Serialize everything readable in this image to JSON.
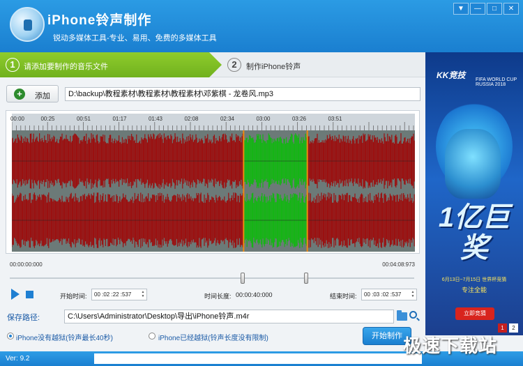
{
  "header": {
    "title": "iPhone铃声制作",
    "subtitle": "锐动多媒体工具-专业、易用、免费的多媒体工具",
    "window_buttons": [
      {
        "icon": "menu-icon",
        "glyph": "▼"
      },
      {
        "icon": "minimize-icon",
        "glyph": "—"
      },
      {
        "icon": "maximize-icon",
        "glyph": "□"
      },
      {
        "icon": "close-icon",
        "glyph": "✕"
      }
    ]
  },
  "steps": [
    {
      "number": "1",
      "label": "请添加要制作的音乐文件"
    },
    {
      "number": "2",
      "label": "制作iPhone铃声"
    }
  ],
  "toolbar": {
    "add_label": "添加",
    "add_glyph": "+"
  },
  "file_path": "D:\\backup\\教程素材\\教程素材\\教程素材\\邓紫棋 - 龙卷风.mp3",
  "timeline": {
    "ticks": [
      "00:00",
      "00:25",
      "00:51",
      "01:17",
      "01:43",
      "02:08",
      "02:34",
      "03:00",
      "03:26",
      "03:51"
    ],
    "start_time": "00:00:00:000",
    "end_time": "00:04:08:973",
    "selection_start_fraction": 0.575,
    "selection_end_fraction": 0.733,
    "colors": {
      "waveform": "#9b1010",
      "selection": "#15b515",
      "background": "#6c7a78",
      "marker": "#f08a12"
    }
  },
  "controls": {
    "start_label": "开始时间:",
    "start_value": "00 :02 :22 :537",
    "length_label": "时间长度:",
    "length_value": "00:00:40:000",
    "end_label": "结束时间:",
    "end_value": "00 :03 :02 :537",
    "spin_up": "▲",
    "spin_down": "▼"
  },
  "save": {
    "label": "保存路径:",
    "path": "C:\\Users\\Administrator\\Desktop\\导出\\iPhone铃声.m4r"
  },
  "options": [
    {
      "label": "iPhone没有越狱(铃声最长40秒)",
      "selected": true
    },
    {
      "label": "iPhone已经越狱(铃声长度没有限制)",
      "selected": false
    }
  ],
  "start_button": "开始制作",
  "status": {
    "version": "Ver: 9.2"
  },
  "ad": {
    "brand": "KK竞技",
    "event": "FIFA WORLD CUP RUSSIA 2018",
    "prize": "1亿巨奖",
    "date_text": "6月13日~7月15日 世界杯竞猜",
    "slogan": "专注全能",
    "button": "立即竞猜",
    "pages": [
      "1",
      "2"
    ]
  },
  "watermark": "极速下载站"
}
